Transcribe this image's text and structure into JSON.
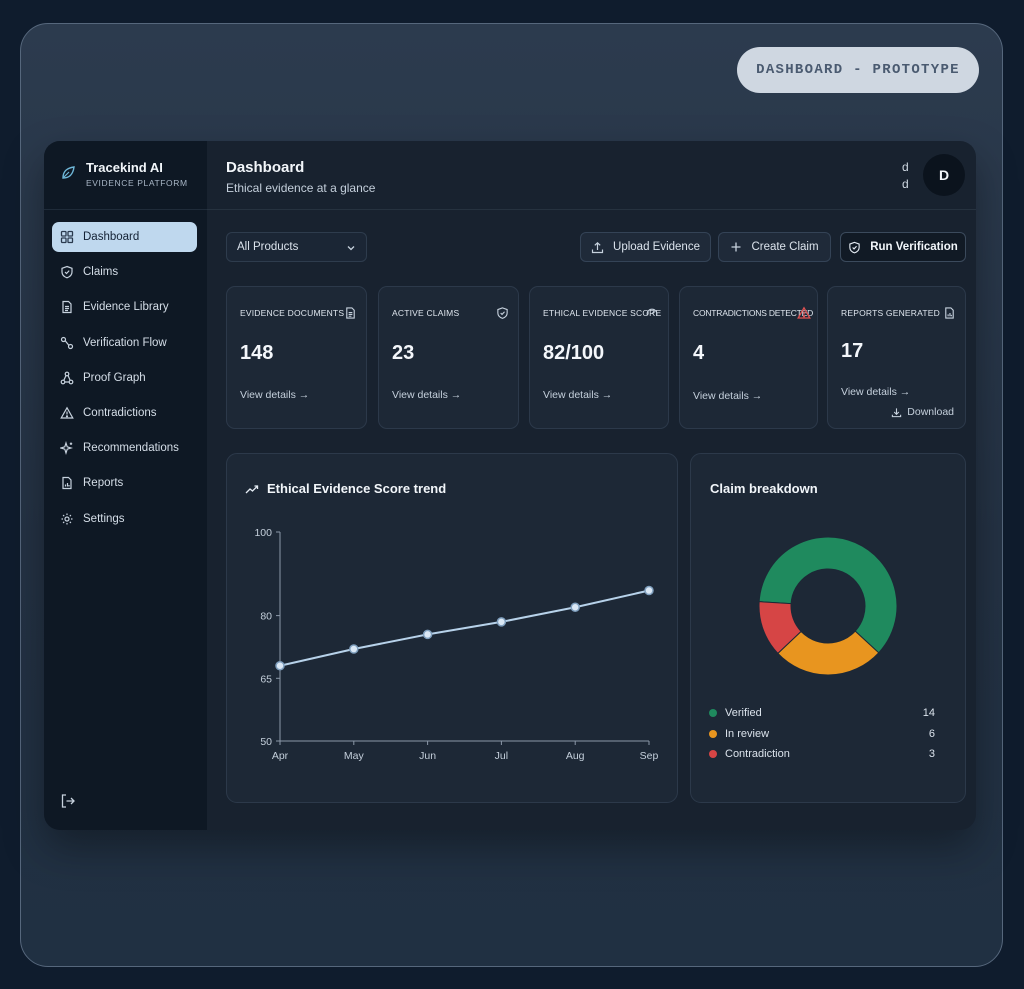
{
  "prototype_label": "DASHBOARD - PROTOTYPE",
  "brand": {
    "name": "Tracekind AI",
    "subtitle": "EVIDENCE PLATFORM"
  },
  "sidebar": {
    "items": [
      {
        "label": "Dashboard",
        "icon": "grid-icon",
        "active": true
      },
      {
        "label": "Claims",
        "icon": "shield-icon"
      },
      {
        "label": "Evidence Library",
        "icon": "document-icon"
      },
      {
        "label": "Verification Flow",
        "icon": "flow-icon"
      },
      {
        "label": "Proof Graph",
        "icon": "graph-icon"
      },
      {
        "label": "Contradictions",
        "icon": "warning-icon"
      },
      {
        "label": "Recommendations",
        "icon": "sparkle-icon"
      },
      {
        "label": "Reports",
        "icon": "report-icon"
      },
      {
        "label": "Settings",
        "icon": "gear-icon"
      }
    ],
    "logout_icon": "logout-icon"
  },
  "header": {
    "title": "Dashboard",
    "subtitle": "Ethical evidence at a glance",
    "user_line1": "d",
    "user_line2": "d",
    "avatar_initial": "D"
  },
  "toolbar": {
    "product_filter": "All Products",
    "upload_label": "Upload Evidence",
    "create_label": "Create Claim",
    "verify_label": "Run Verification"
  },
  "cards": [
    {
      "label": "EVIDENCE DOCUMENTS",
      "value": "148",
      "link": "View details →",
      "icon": "document-icon"
    },
    {
      "label": "ACTIVE CLAIMS",
      "value": "23",
      "link": "View details →",
      "icon": "shield-icon"
    },
    {
      "label": "ETHICAL EVIDENCE SCORE",
      "value": "82/100",
      "link": "View details →",
      "icon": "gauge-icon"
    },
    {
      "label": "CONTRADICTIONS DETECTED",
      "value": "4",
      "link": "View details →",
      "icon": "warning-icon"
    },
    {
      "label": "REPORTS GENERATED",
      "value": "17",
      "link": "View details →",
      "icon": "report-icon",
      "extra": "Download"
    }
  ],
  "colors": {
    "line": "#b7d2ea",
    "verified": "#1f8a5e",
    "in_review": "#e8951f",
    "contradiction": "#d64545",
    "active_nav": "#bfd8ee",
    "warning_icon": "#e05252"
  },
  "trend_panel": {
    "title": "Ethical Evidence Score trend"
  },
  "breakdown_panel": {
    "title": "Claim breakdown"
  },
  "chart_data": [
    {
      "type": "line",
      "title": "Ethical Evidence Score trend",
      "xlabel": "",
      "ylabel": "",
      "categories": [
        "Apr",
        "May",
        "Jun",
        "Jul",
        "Aug",
        "Sep"
      ],
      "series": [
        {
          "values": [
            68,
            72,
            75.5,
            78.5,
            82,
            86
          ]
        }
      ],
      "yticks": [
        50,
        65,
        80,
        100
      ],
      "ylim": [
        50,
        100
      ],
      "grid": false
    },
    {
      "type": "pie",
      "title": "Claim breakdown",
      "donut": true,
      "categories": [
        "Verified",
        "In review",
        "Contradiction"
      ],
      "values": [
        14,
        6,
        3
      ],
      "legend": "bottom"
    }
  ]
}
